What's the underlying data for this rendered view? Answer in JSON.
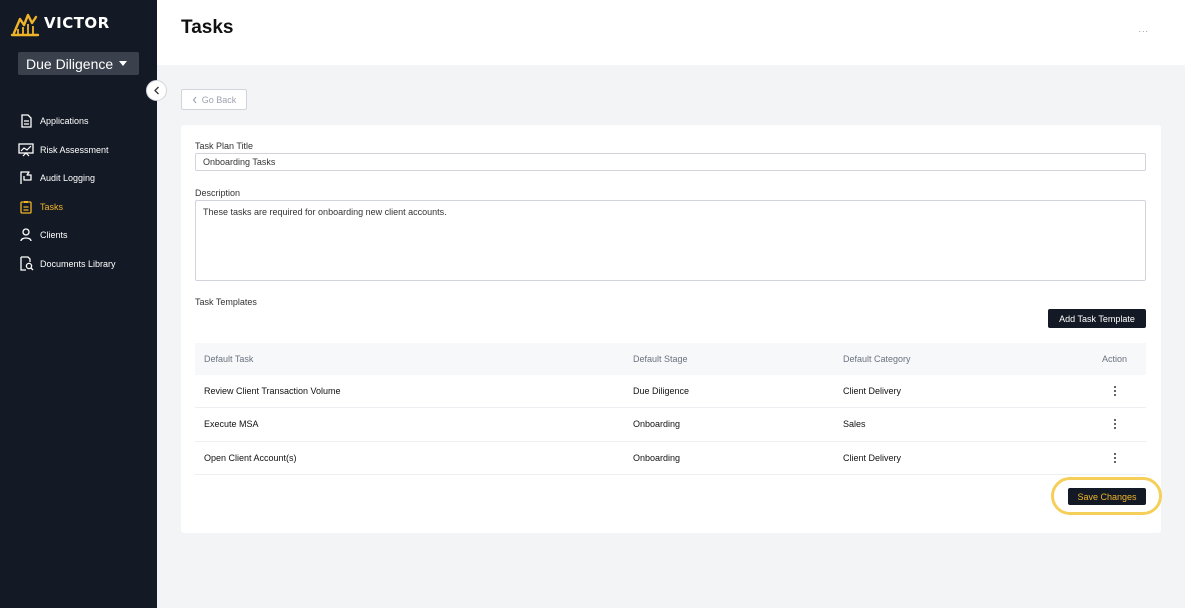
{
  "app": {
    "logo_text": "VICTOR",
    "workspace": "Due Diligence"
  },
  "sidebar": {
    "items": [
      {
        "label": "Applications",
        "icon": "document-icon",
        "active": false
      },
      {
        "label": "Risk Assessment",
        "icon": "chart-presentation-icon",
        "active": false
      },
      {
        "label": "Audit Logging",
        "icon": "flag-icon",
        "active": false
      },
      {
        "label": "Tasks",
        "icon": "clipboard-icon",
        "active": true
      },
      {
        "label": "Clients",
        "icon": "user-icon",
        "active": false
      },
      {
        "label": "Documents Library",
        "icon": "document-search-icon",
        "active": false
      }
    ]
  },
  "header": {
    "title": "Tasks",
    "more": "..."
  },
  "go_back_label": "Go Back",
  "form": {
    "title_label": "Task Plan Title",
    "title_value": "Onboarding Tasks",
    "description_label": "Description",
    "description_value": "These tasks are required for onboarding new client accounts.",
    "templates_label": "Task Templates",
    "add_button": "Add Task Template",
    "save_button": "Save Changes"
  },
  "table": {
    "headers": [
      "Default Task",
      "Default Stage",
      "Default Category",
      "Action"
    ],
    "rows": [
      [
        "Review Client Transaction Volume",
        "Due Diligence",
        "Client Delivery"
      ],
      [
        "Execute MSA",
        "Onboarding",
        "Sales"
      ],
      [
        "Open Client Account(s)",
        "Onboarding",
        "Client Delivery"
      ]
    ]
  },
  "colors": {
    "sidebar_bg": "#141a25",
    "accent": "#f0b429",
    "highlight": "#f5cf5a"
  }
}
